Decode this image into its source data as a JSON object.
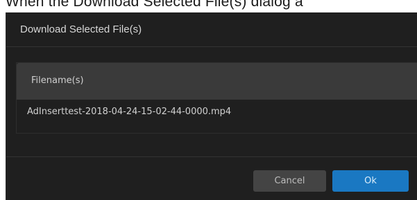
{
  "page": {
    "caption": "When the Download Selected File(s) dialog a"
  },
  "dialog": {
    "title": "Download Selected File(s)",
    "table": {
      "column_header": "Filename(s)",
      "rows": [
        {
          "filename": "AdInserttest-2018-04-24-15-02-44-0000.mp4"
        }
      ]
    },
    "buttons": {
      "cancel_label": "Cancel",
      "ok_label": "Ok"
    }
  },
  "colors": {
    "dialog_background": "#1f1f1f",
    "table_header_background": "#3a3a3a",
    "ok_button": "#1a78c2",
    "cancel_button": "#444444"
  }
}
